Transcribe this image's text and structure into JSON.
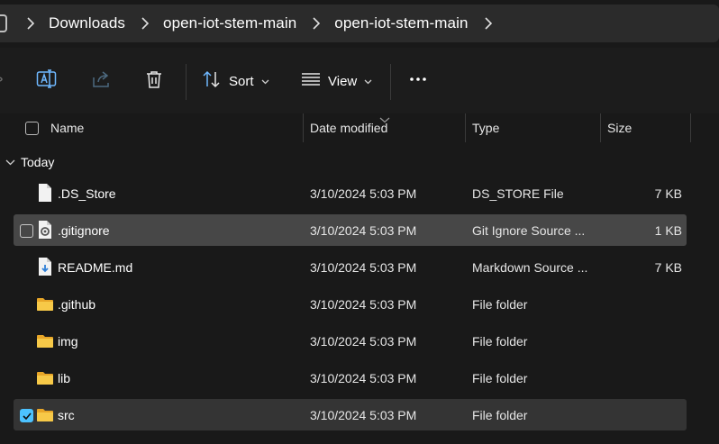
{
  "breadcrumb": {
    "items": [
      "Downloads",
      "open-iot-stem-main",
      "open-iot-stem-main"
    ]
  },
  "toolbar": {
    "sort_label": "Sort",
    "view_label": "View"
  },
  "columns": {
    "name": "Name",
    "date": "Date modified",
    "type": "Type",
    "size": "Size"
  },
  "group": {
    "label": "Today"
  },
  "files": [
    {
      "name": ".DS_Store",
      "date": "3/10/2024 5:03 PM",
      "type": "DS_STORE File",
      "size": "7 KB",
      "icon": "file-icon",
      "state": "normal"
    },
    {
      "name": ".gitignore",
      "date": "3/10/2024 5:03 PM",
      "type": "Git Ignore Source ...",
      "size": "1 KB",
      "icon": "settings-file-icon",
      "state": "hover"
    },
    {
      "name": "README.md",
      "date": "3/10/2024 5:03 PM",
      "type": "Markdown Source ...",
      "size": "7 KB",
      "icon": "markdown-file-icon",
      "state": "normal"
    },
    {
      "name": ".github",
      "date": "3/10/2024 5:03 PM",
      "type": "File folder",
      "size": "",
      "icon": "folder-icon",
      "state": "normal"
    },
    {
      "name": "img",
      "date": "3/10/2024 5:03 PM",
      "type": "File folder",
      "size": "",
      "icon": "folder-icon",
      "state": "normal"
    },
    {
      "name": "lib",
      "date": "3/10/2024 5:03 PM",
      "type": "File folder",
      "size": "",
      "icon": "folder-icon",
      "state": "normal"
    },
    {
      "name": "src",
      "date": "3/10/2024 5:03 PM",
      "type": "File folder",
      "size": "",
      "icon": "folder-icon",
      "state": "selected"
    }
  ],
  "colors": {
    "background": "#191919",
    "accent": "#4cc2ff",
    "folder": "#f5c542"
  }
}
